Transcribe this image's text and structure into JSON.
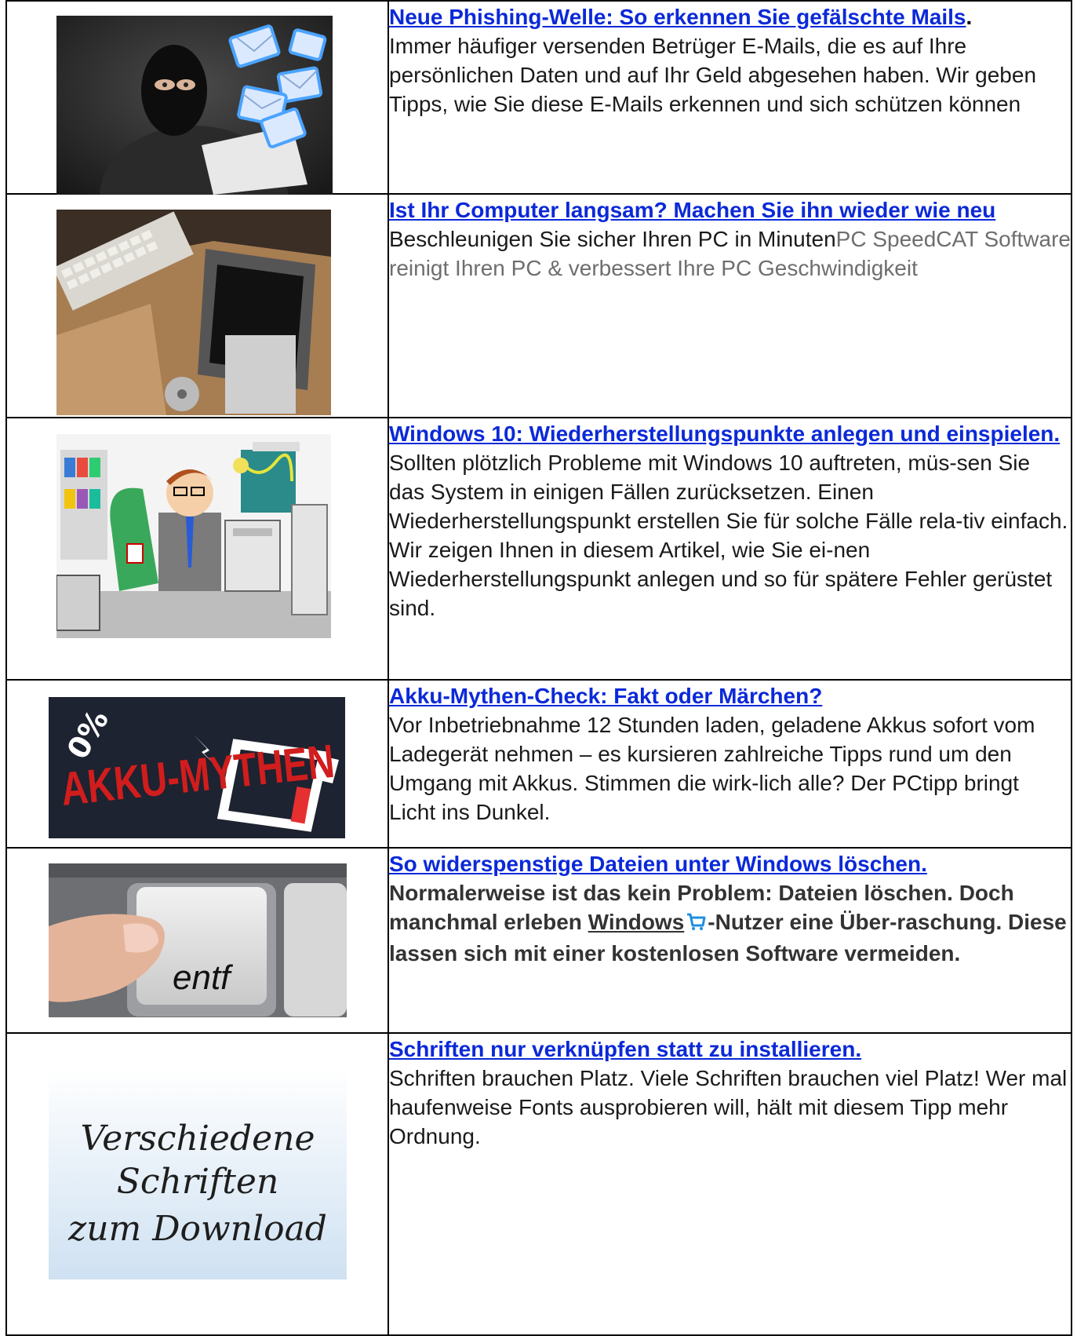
{
  "articles": [
    {
      "title": "Neue Phishing-Welle: So erkennen Sie gefälschte Mails",
      "title_suffix": ".",
      "body": "Immer häufiger versenden Betrüger E-Mails, die es auf Ihre persönlichen Daten und auf Ihr Geld abgesehen haben. Wir geben Tipps, wie Sie diese E-Mails erkennen und sich schützen können",
      "image": "hacker-with-laptop-and-envelopes"
    },
    {
      "title": "Ist Ihr Computer langsam? Machen Sie ihn wieder wie neu",
      "body_part1": "Beschleunigen Sie sicher Ihren PC in Minuten",
      "body_part2": "PC SpeedCAT Software reinigt Ihren PC & verbessert Ihre PC Geschwindigkeit",
      "image": "old-computer-in-box"
    },
    {
      "title": "Windows 10: Wiederherstellungspunkte anlegen und einspielen.",
      "body": "Sollten plötzlich Probleme mit Windows 10 auftreten, müs-sen Sie das System in einigen Fällen zurücksetzen. Einen Wiederherstellungspunkt erstellen Sie für solche Fälle rela-tiv einfach. Wir zeigen Ihnen in diesem Artikel, wie Sie ei-nen Wiederherstellungspunkt anlegen und so für spätere Fehler gerüstet sind.",
      "image": "stressed-office-worker-cartoon"
    },
    {
      "title": "Akku-Mythen-Check: Fakt oder Märchen?",
      "body": "Vor Inbetriebnahme 12 Stunden laden, geladene Akkus sofort vom Ladegerät nehmen – es kursieren zahlreiche Tipps rund um den Umgang mit Akkus. Stimmen die wirk-lich alle? Der PCtipp bringt Licht ins Dunkel.",
      "image": "akku-mythen-battery",
      "image_text": "AKKU-MYTHEN",
      "image_percent": "0%"
    },
    {
      "title": "So widerspenstige Dateien unter Windows löschen.",
      "body_part1": "Normalerweise ist das kein Problem: Dateien löschen. Doch manchmal erleben ",
      "link_text": "Windows",
      "body_part2": "-Nutzer eine Über-raschung. Diese lassen sich mit einer kostenlosen Software vermeiden.",
      "image": "finger-on-entf-key",
      "image_text": "entf"
    },
    {
      "title": "Schriften nur verknüpfen statt zu installieren.",
      "body": "Schriften brauchen Platz. Viele Schriften brauchen viel Platz! Wer mal haufenweise Fonts ausprobieren will, hält mit diesem Tipp mehr Ordnung.",
      "image": "handwriting-fonts",
      "image_lines": [
        "Verschiedene",
        "Schriften",
        "zum Download"
      ]
    }
  ],
  "colors": {
    "link": "#0b29d8",
    "grey": "#6e6e6e"
  }
}
